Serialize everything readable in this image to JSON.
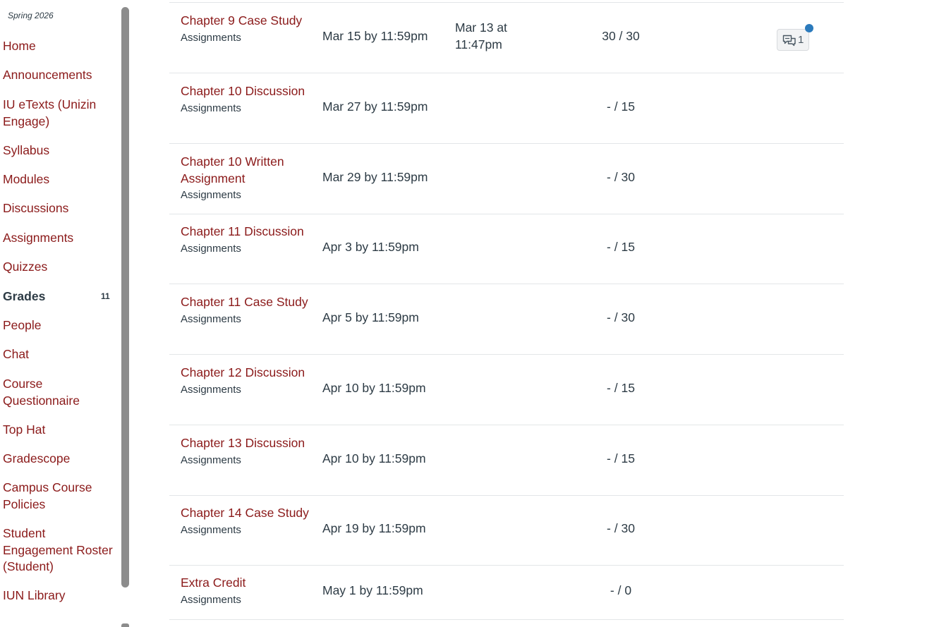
{
  "sidebar": {
    "term": "Spring 2026",
    "items": [
      {
        "label": "Home"
      },
      {
        "label": "Announcements"
      },
      {
        "label": "IU eTexts (Unizin Engage)"
      },
      {
        "label": "Syllabus"
      },
      {
        "label": "Modules"
      },
      {
        "label": "Discussions"
      },
      {
        "label": "Assignments"
      },
      {
        "label": "Quizzes"
      },
      {
        "label": "Grades",
        "badge": "11",
        "active": true
      },
      {
        "label": "People"
      },
      {
        "label": "Chat"
      },
      {
        "label": "Course Questionnaire"
      },
      {
        "label": "Top Hat"
      },
      {
        "label": "Gradescope"
      },
      {
        "label": "Campus Course Policies"
      },
      {
        "label": "Student Engagement Roster (Student)"
      },
      {
        "label": "IUN Library"
      }
    ]
  },
  "grades": {
    "rows": [
      {
        "name": "Chapter 9 Case Study",
        "type": "Assignments",
        "due": "Mar 15 by 11:59pm",
        "submitted": "Mar 13 at 11:47pm",
        "score": "30 / 30",
        "comments": "1",
        "unread": true
      },
      {
        "name": "Chapter 10 Discussion",
        "type": "Assignments",
        "due": "Mar 27 by 11:59pm",
        "submitted": "",
        "score": "- / 15"
      },
      {
        "name": "Chapter 10 Written Assignment",
        "type": "Assignments",
        "due": "Mar 29 by 11:59pm",
        "submitted": "",
        "score": "- / 30"
      },
      {
        "name": "Chapter 11 Discussion",
        "type": "Assignments",
        "due": "Apr 3 by 11:59pm",
        "submitted": "",
        "score": "- / 15"
      },
      {
        "name": "Chapter 11 Case Study",
        "type": "Assignments",
        "due": "Apr 5 by 11:59pm",
        "submitted": "",
        "score": "- / 30"
      },
      {
        "name": "Chapter 12 Discussion",
        "type": "Assignments",
        "due": "Apr 10 by 11:59pm",
        "submitted": "",
        "score": "- / 15"
      },
      {
        "name": "Chapter 13 Discussion",
        "type": "Assignments",
        "due": "Apr 10 by 11:59pm",
        "submitted": "",
        "score": "- / 15"
      },
      {
        "name": "Chapter 14 Case Study",
        "type": "Assignments",
        "due": "Apr 19 by 11:59pm",
        "submitted": "",
        "score": "- / 30"
      },
      {
        "name": "Extra Credit",
        "type": "Assignments",
        "due": "May 1 by 11:59pm",
        "submitted": "",
        "score": "- / 0"
      }
    ]
  },
  "colors": {
    "link": "#8b1a1a",
    "text": "#2d3b45",
    "unread_dot": "#2b7abc",
    "divider": "#e3e6e8"
  },
  "icons": {
    "comment": "comment-bubbles-icon"
  }
}
